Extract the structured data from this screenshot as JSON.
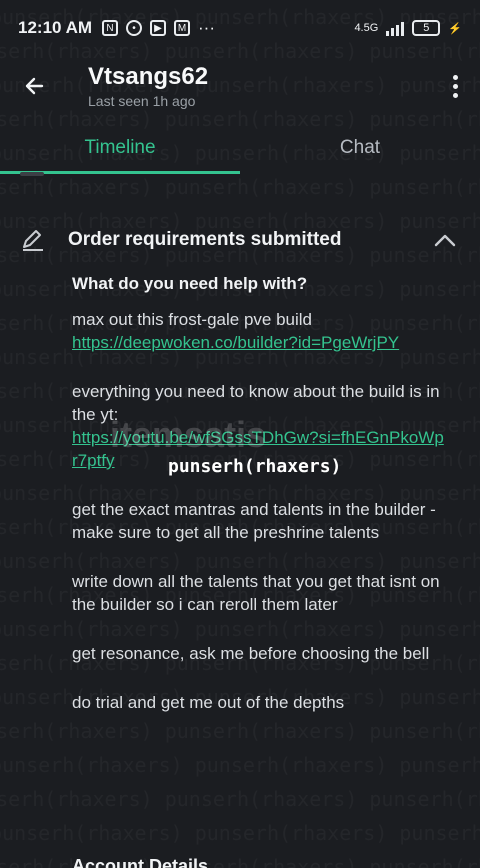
{
  "status_bar": {
    "time": "12:10 AM",
    "network_label": "4.5G",
    "battery": "5"
  },
  "header": {
    "username": "Vtsangs62",
    "last_seen": "Last seen 1h ago"
  },
  "tabs": [
    {
      "label": "Timeline"
    },
    {
      "label": "Chat"
    }
  ],
  "order": {
    "title": "Order requirements submitted",
    "question": "What do you need help with?",
    "paragraphs": [
      {
        "text": "max out this frost-gale pve build",
        "link": "https://deepwoken.co/builder?id=PgeWrjPY"
      },
      {
        "text": "everything you need to know about the build is in the yt:",
        "link": "https://youtu.be/wfSGssTDhGw?si=fhEGnPkoWpr7ptfy"
      },
      {
        "text": "get the exact mantras and talents in the builder - make sure to get all the preshrine talents"
      },
      {
        "text": "write down all the talents that you get that isnt on the builder so i can reroll them later"
      },
      {
        "text": "get resonance, ask me before choosing the bell"
      },
      {
        "text": "do trial and get me out of the depths"
      }
    ]
  },
  "overlay": {
    "center_mark": "punserh(rhaxers)",
    "logo": "itemsatis",
    "bg_mark": "punserh(rhaxers)"
  },
  "account_details": "Account Details",
  "colors": {
    "accent": "#34c38f",
    "background": "#1b1d21"
  }
}
